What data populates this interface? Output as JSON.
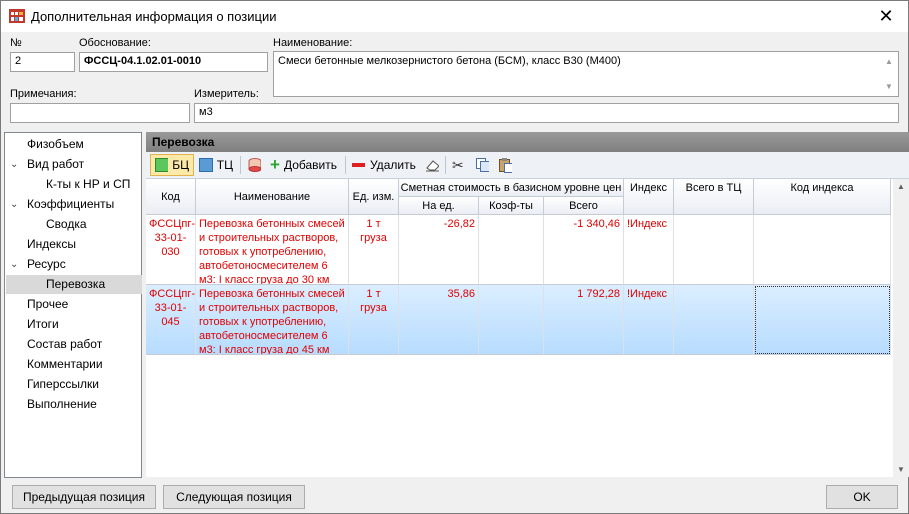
{
  "window": {
    "title": "Дополнительная информация о позиции"
  },
  "form": {
    "num_label": "№",
    "num_value": "2",
    "basis_label": "Обоснование:",
    "basis_value": "ФССЦ-04.1.02.01-0010",
    "name_label": "Наименование:",
    "name_value": "Смеси бетонные мелкозернистого бетона (БСМ), класс В30 (М400)",
    "notes_label": "Примечания:",
    "notes_value": "",
    "unit_label": "Измеритель:",
    "unit_value": "м3"
  },
  "nav": {
    "items": [
      {
        "label": "Физобъем",
        "chevron": ""
      },
      {
        "label": "Вид работ",
        "chevron": "v"
      },
      {
        "label": "К-ты к НР и СП",
        "chevron": ""
      },
      {
        "label": "Коэффициенты",
        "chevron": "v"
      },
      {
        "label": "Сводка",
        "chevron": ""
      },
      {
        "label": "Индексы",
        "chevron": ""
      },
      {
        "label": "Ресурс",
        "chevron": "v"
      },
      {
        "label": "Перевозка",
        "chevron": ""
      },
      {
        "label": "Прочее",
        "chevron": ""
      },
      {
        "label": "Итоги",
        "chevron": ""
      },
      {
        "label": "Состав работ",
        "chevron": ""
      },
      {
        "label": "Комментарии",
        "chevron": ""
      },
      {
        "label": "Гиперссылки",
        "chevron": ""
      },
      {
        "label": "Выполнение",
        "chevron": ""
      }
    ],
    "selected": "Перевозка"
  },
  "panel": {
    "title": "Перевозка"
  },
  "toolbar": {
    "bc_label": "БЦ",
    "tc_label": "ТЦ",
    "add_label": "Добавить",
    "delete_label": "Удалить",
    "icons": [
      "eraser-icon",
      "cut-icon",
      "copy-icon",
      "paste-icon"
    ]
  },
  "table": {
    "headers": {
      "code": "Код",
      "name": "Наименование",
      "unit": "Ед. изм.",
      "base_cost": "Сметная стоимость в базисном уровне цен",
      "per_unit": "На ед.",
      "coef": "Коэф-ты",
      "total": "Всего",
      "index": "Индекс",
      "total_tc": "Всего в ТЦ",
      "index_code": "Код индекса"
    },
    "rows": [
      {
        "code": "ФССЦпг-03-33-01-030",
        "name": "Перевозка бетонных смесей и строительных растворов, готовых к употреблению, автобетоносмесителем 6 м3: I класс груза до 30 км",
        "unit": "1 т груза",
        "per_unit": "-26,82",
        "coef": "",
        "total": "-1 340,46",
        "index": "!Индекс",
        "total_tc": "",
        "index_code": ""
      },
      {
        "code": "ФССЦпг-03-33-01-045",
        "name": "Перевозка бетонных смесей и строительных растворов, готовых к употреблению, автобетоносмесителем 6 м3: I класс груза до 45 км",
        "unit": "1 т груза",
        "per_unit": "35,86",
        "coef": "",
        "total": "1 792,28",
        "index": "!Индекс",
        "total_tc": "",
        "index_code": ""
      }
    ]
  },
  "buttons": {
    "prev": "Предыдущая позиция",
    "next": "Следующая позиция",
    "ok": "OK"
  }
}
